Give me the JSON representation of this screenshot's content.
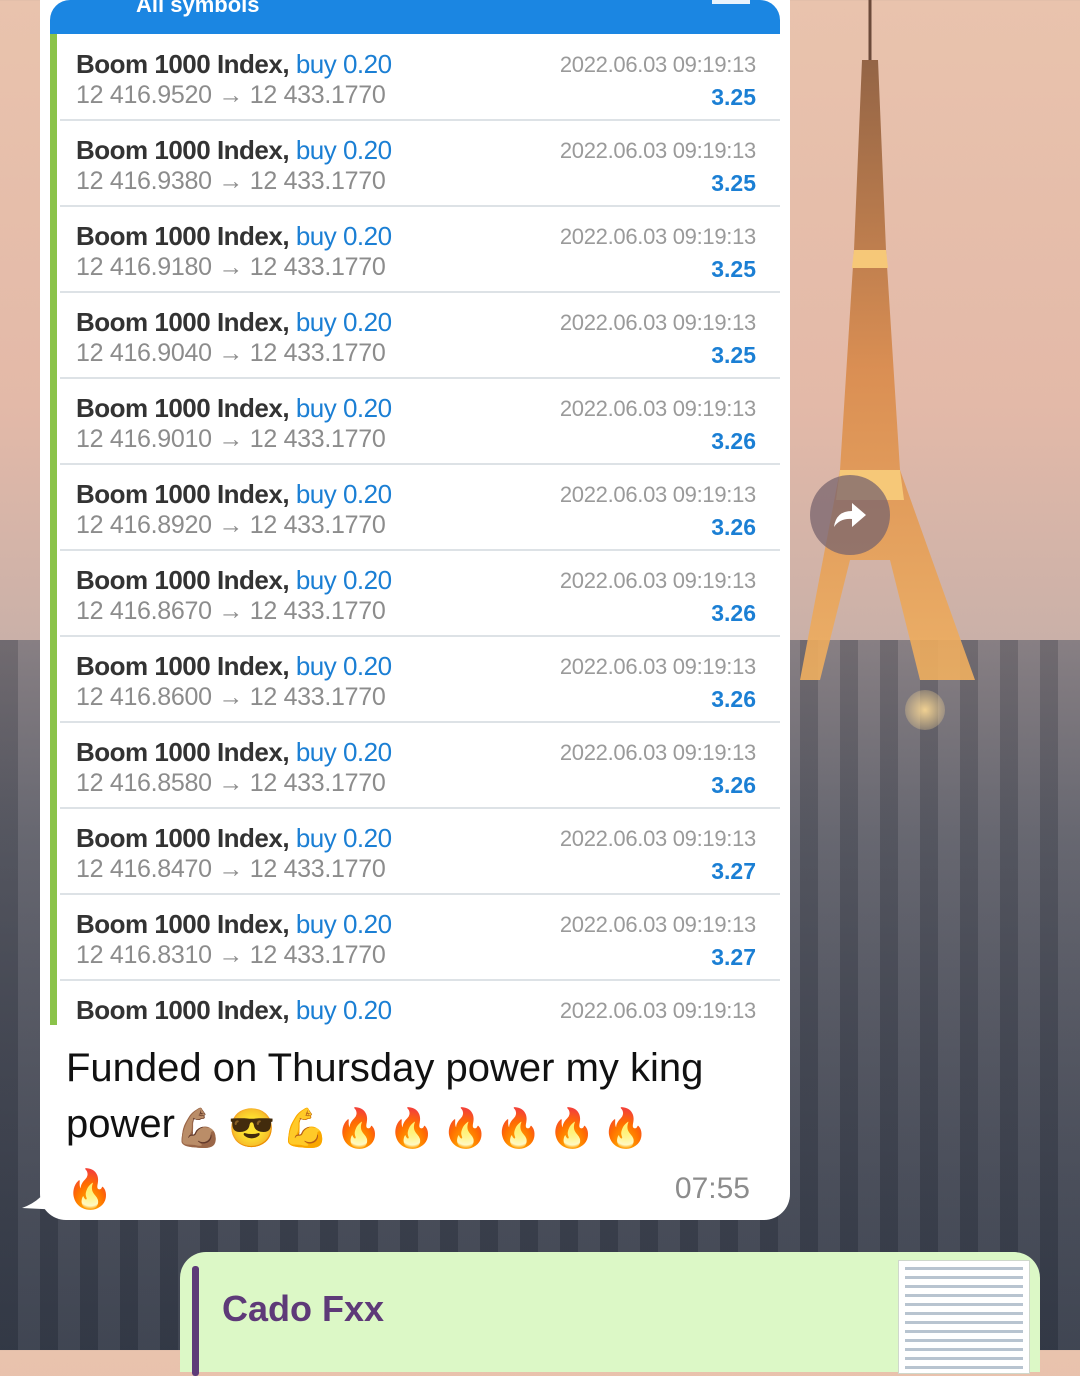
{
  "screenshot": {
    "header_title": "All symbols",
    "trades": [
      {
        "symbol": "Boom 1000 Index,",
        "side": "buy 0.20",
        "prices": "12 416.9520 → 12 433.1770",
        "time": "2022.06.03 09:19:13",
        "profit": "3.25"
      },
      {
        "symbol": "Boom 1000 Index,",
        "side": "buy 0.20",
        "prices": "12 416.9380 → 12 433.1770",
        "time": "2022.06.03 09:19:13",
        "profit": "3.25"
      },
      {
        "symbol": "Boom 1000 Index,",
        "side": "buy 0.20",
        "prices": "12 416.9180 → 12 433.1770",
        "time": "2022.06.03 09:19:13",
        "profit": "3.25"
      },
      {
        "symbol": "Boom 1000 Index,",
        "side": "buy 0.20",
        "prices": "12 416.9040 → 12 433.1770",
        "time": "2022.06.03 09:19:13",
        "profit": "3.25"
      },
      {
        "symbol": "Boom 1000 Index,",
        "side": "buy 0.20",
        "prices": "12 416.9010 → 12 433.1770",
        "time": "2022.06.03 09:19:13",
        "profit": "3.26"
      },
      {
        "symbol": "Boom 1000 Index,",
        "side": "buy 0.20",
        "prices": "12 416.8920 → 12 433.1770",
        "time": "2022.06.03 09:19:13",
        "profit": "3.26"
      },
      {
        "symbol": "Boom 1000 Index,",
        "side": "buy 0.20",
        "prices": "12 416.8670 → 12 433.1770",
        "time": "2022.06.03 09:19:13",
        "profit": "3.26"
      },
      {
        "symbol": "Boom 1000 Index,",
        "side": "buy 0.20",
        "prices": "12 416.8600 → 12 433.1770",
        "time": "2022.06.03 09:19:13",
        "profit": "3.26"
      },
      {
        "symbol": "Boom 1000 Index,",
        "side": "buy 0.20",
        "prices": "12 416.8580 → 12 433.1770",
        "time": "2022.06.03 09:19:13",
        "profit": "3.26"
      },
      {
        "symbol": "Boom 1000 Index,",
        "side": "buy 0.20",
        "prices": "12 416.8470 → 12 433.1770",
        "time": "2022.06.03 09:19:13",
        "profit": "3.27"
      },
      {
        "symbol": "Boom 1000 Index,",
        "side": "buy 0.20",
        "prices": "12 416.8310 → 12 433.1770",
        "time": "2022.06.03 09:19:13",
        "profit": "3.27"
      },
      {
        "symbol": "Boom 1000 Index,",
        "side": "buy 0.20",
        "prices": "",
        "time": "2022.06.03 09:19:13",
        "profit": ""
      }
    ]
  },
  "message": {
    "line1": "Funded on Thursday power my king",
    "line2_word": "power",
    "emojis": [
      "💪🏽",
      "😎",
      "💪",
      "🔥",
      "🔥",
      "🔥",
      "🔥",
      "🔥",
      "🔥"
    ],
    "last_emoji": "🔥",
    "time": "07:55"
  },
  "reply": {
    "sender": "Cado Fxx"
  },
  "icons": {
    "forward": "forward-arrow-icon"
  },
  "colors": {
    "accent_blue": "#1b86e2",
    "accent_green": "#8bc34a",
    "reply_bubble": "#dcf8c6",
    "reply_name": "#5e3a78"
  }
}
